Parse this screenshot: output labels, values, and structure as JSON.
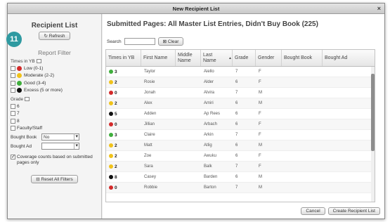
{
  "window": {
    "title": "New Recipient List",
    "close_glyph": "×"
  },
  "badge": "11",
  "sidebar": {
    "title": "Recipient List",
    "refresh_label": "Refresh",
    "report_filter": "Report Filter",
    "times_in_yb_label": "Times in YB",
    "times_options": [
      {
        "label": "Low (0-1)",
        "color": "#d32a2a"
      },
      {
        "label": "Moderate (2-2)",
        "color": "#f0c21a"
      },
      {
        "label": "Good (3-4)",
        "color": "#3fae3c"
      },
      {
        "label": "Excess (5 or more)",
        "color": "#111111"
      }
    ],
    "grade_label": "Grade",
    "grade_options": [
      "6",
      "7",
      "8"
    ],
    "faculty_label": "Faculty/Staff",
    "bought_book_label": "Bought Book",
    "bought_book_value": "No",
    "bought_ad_label": "Bought Ad",
    "bought_ad_value": "",
    "coverage_label": "Coverage counts based on submitted pages only",
    "reset_label": "Reset All Filters"
  },
  "main": {
    "title": "Submitted Pages: All Master List Entries, Didn't Buy Book (225)",
    "search_label": "Search",
    "clear_label": "Clear",
    "columns": [
      "Times in YB",
      "First Name",
      "Middle Name",
      "Last Name",
      "Grade",
      "Gender",
      "Bought Book",
      "Bought Ad"
    ],
    "sort_indicator": "▲",
    "rows": [
      {
        "color": "#3fae3c",
        "times": "3",
        "first": "Taylor",
        "last": "Aiello",
        "grade": "7",
        "gender": "F"
      },
      {
        "color": "#f0c21a",
        "times": "2",
        "first": "Rosie",
        "last": "Alder",
        "grade": "6",
        "gender": "F"
      },
      {
        "color": "#d32a2a",
        "times": "0",
        "first": "Jonah",
        "last": "Alvira",
        "grade": "7",
        "gender": "M"
      },
      {
        "color": "#f0c21a",
        "times": "2",
        "first": "Alex",
        "last": "Amiri",
        "grade": "6",
        "gender": "M"
      },
      {
        "color": "#111111",
        "times": "5",
        "first": "Adden",
        "last": "Ap Rees",
        "grade": "6",
        "gender": "F"
      },
      {
        "color": "#d32a2a",
        "times": "0",
        "first": "Jillian",
        "last": "Arbach",
        "grade": "6",
        "gender": "F"
      },
      {
        "color": "#3fae3c",
        "times": "3",
        "first": "Claire",
        "last": "Arkin",
        "grade": "7",
        "gender": "F"
      },
      {
        "color": "#f0c21a",
        "times": "2",
        "first": "Matt",
        "last": "Atlig",
        "grade": "6",
        "gender": "M"
      },
      {
        "color": "#f0c21a",
        "times": "2",
        "first": "Zoe",
        "last": "Awuku",
        "grade": "6",
        "gender": "F"
      },
      {
        "color": "#f0c21a",
        "times": "2",
        "first": "Sara",
        "last": "Balk",
        "grade": "7",
        "gender": "F"
      },
      {
        "color": "#111111",
        "times": "8",
        "first": "Casey",
        "last": "Barden",
        "grade": "6",
        "gender": "M"
      },
      {
        "color": "#d32a2a",
        "times": "0",
        "first": "Robbie",
        "last": "Barton",
        "grade": "7",
        "gender": "M"
      }
    ],
    "cancel_label": "Cancel",
    "create_label": "Create Recipient List"
  }
}
